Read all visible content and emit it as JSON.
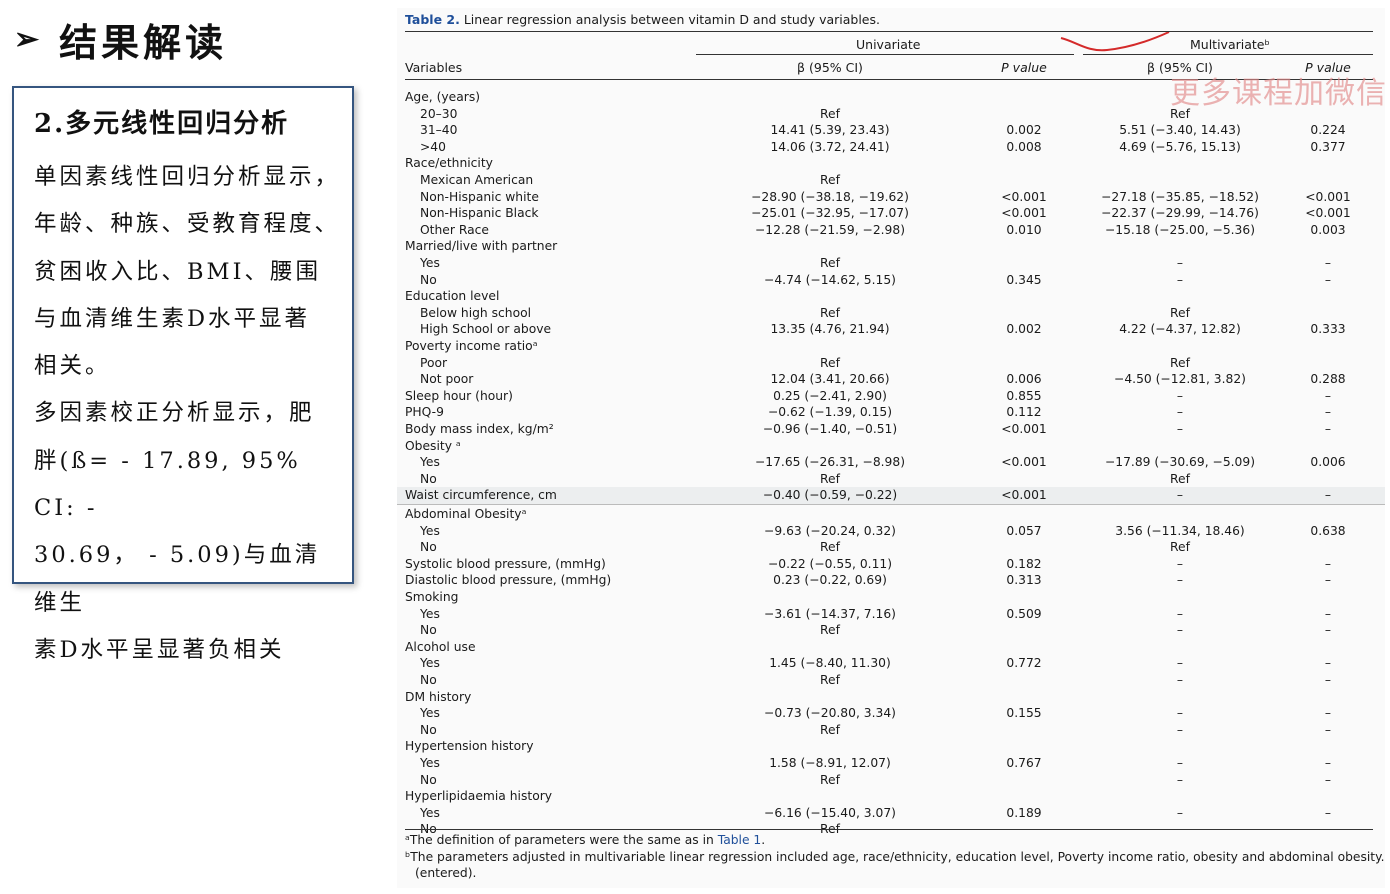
{
  "slide": {
    "title_arrow": "➢",
    "title": "结果解读"
  },
  "summary": {
    "heading": "2.多元线性回归分析",
    "lines": [
      "单因素线性回归分析显示，",
      "年龄、种族、受教育程度、",
      "贫困收入比、BMI、腰围",
      "与血清维生素D水平显著",
      "相关。",
      "多因素校正分析显示，肥",
      "胖(ß= - 17.89, 95% CI: -",
      "30.69，  - 5.09)与血清维生",
      "素D水平呈显著负相关"
    ]
  },
  "table": {
    "caption_label": "Table 2.",
    "caption_text": "Linear regression analysis between vitamin D and study variables.",
    "group_univariate": "Univariate",
    "group_multivariate": "Multivariateᵇ",
    "col_variables": "Variables",
    "col_beta_uni": "β (95% CI)",
    "col_p_uni": "P value",
    "col_beta_multi": "β (95% CI)",
    "col_p_multi": "P value",
    "rows": [
      {
        "label": "Age, (years)",
        "sub": false,
        "b1": "",
        "p1": "",
        "b2": "",
        "p2": ""
      },
      {
        "label": "20–30",
        "sub": true,
        "b1": "Ref",
        "p1": "",
        "b2": "Ref",
        "p2": ""
      },
      {
        "label": "31–40",
        "sub": true,
        "b1": "14.41 (5.39, 23.43)",
        "p1": "0.002",
        "b2": "5.51 (−3.40, 14.43)",
        "p2": "0.224"
      },
      {
        "label": ">40",
        "sub": true,
        "b1": "14.06 (3.72, 24.41)",
        "p1": "0.008",
        "b2": "4.69 (−5.76, 15.13)",
        "p2": "0.377"
      },
      {
        "label": "Race/ethnicity",
        "sub": false,
        "b1": "",
        "p1": "",
        "b2": "",
        "p2": ""
      },
      {
        "label": "Mexican American",
        "sub": true,
        "b1": "Ref",
        "p1": "",
        "b2": "",
        "p2": ""
      },
      {
        "label": "Non-Hispanic white",
        "sub": true,
        "b1": "−28.90 (−38.18, −19.62)",
        "p1": "<0.001",
        "b2": "−27.18 (−35.85, −18.52)",
        "p2": "<0.001"
      },
      {
        "label": "Non-Hispanic Black",
        "sub": true,
        "b1": "−25.01 (−32.95, −17.07)",
        "p1": "<0.001",
        "b2": "−22.37 (−29.99, −14.76)",
        "p2": "<0.001"
      },
      {
        "label": "Other Race",
        "sub": true,
        "b1": "−12.28 (−21.59, −2.98)",
        "p1": "0.010",
        "b2": "−15.18 (−25.00, −5.36)",
        "p2": "0.003"
      },
      {
        "label": "Married/live with partner",
        "sub": false,
        "b1": "",
        "p1": "",
        "b2": "",
        "p2": ""
      },
      {
        "label": "Yes",
        "sub": true,
        "b1": "Ref",
        "p1": "",
        "b2": "–",
        "p2": "–"
      },
      {
        "label": "No",
        "sub": true,
        "b1": "−4.74 (−14.62, 5.15)",
        "p1": "0.345",
        "b2": "–",
        "p2": "–"
      },
      {
        "label": "Education level",
        "sub": false,
        "b1": "",
        "p1": "",
        "b2": "",
        "p2": ""
      },
      {
        "label": "Below high school",
        "sub": true,
        "b1": "Ref",
        "p1": "",
        "b2": "Ref",
        "p2": ""
      },
      {
        "label": "High School or above",
        "sub": true,
        "b1": "13.35 (4.76, 21.94)",
        "p1": "0.002",
        "b2": "4.22 (−4.37, 12.82)",
        "p2": "0.333"
      },
      {
        "label": "Poverty income ratioᵃ",
        "sub": false,
        "b1": "",
        "p1": "",
        "b2": "",
        "p2": ""
      },
      {
        "label": "Poor",
        "sub": true,
        "b1": "Ref",
        "p1": "",
        "b2": "Ref",
        "p2": ""
      },
      {
        "label": "Not poor",
        "sub": true,
        "b1": "12.04 (3.41, 20.66)",
        "p1": "0.006",
        "b2": "−4.50 (−12.81, 3.82)",
        "p2": "0.288"
      },
      {
        "label": "Sleep hour (hour)",
        "sub": false,
        "b1": "0.25 (−2.41, 2.90)",
        "p1": "0.855",
        "b2": "–",
        "p2": "–"
      },
      {
        "label": "PHQ-9",
        "sub": false,
        "b1": "−0.62 (−1.39, 0.15)",
        "p1": "0.112",
        "b2": "–",
        "p2": "–"
      },
      {
        "label": "Body mass index, kg/m²",
        "sub": false,
        "b1": "−0.96 (−1.40, −0.51)",
        "p1": "<0.001",
        "b2": "–",
        "p2": "–"
      },
      {
        "label": "Obesity ᵃ",
        "sub": false,
        "b1": "",
        "p1": "",
        "b2": "",
        "p2": ""
      },
      {
        "label": "Yes",
        "sub": true,
        "b1": "−17.65 (−26.31, −8.98)",
        "p1": "<0.001",
        "b2": "−17.89 (−30.69, −5.09)",
        "p2": "0.006"
      },
      {
        "label": "No",
        "sub": true,
        "b1": "Ref",
        "p1": "",
        "b2": "Ref",
        "p2": ""
      },
      {
        "label": "Waist circumference, cm",
        "sub": false,
        "shade": true,
        "b1": "−0.40 (−0.59, −0.22)",
        "p1": "<0.001",
        "b2": "–",
        "p2": "–"
      },
      {
        "label": "Abdominal Obesityᵃ",
        "sub": false,
        "b1": "",
        "p1": "",
        "b2": "",
        "p2": ""
      },
      {
        "label": "Yes",
        "sub": true,
        "b1": "−9.63 (−20.24, 0.32)",
        "p1": "0.057",
        "b2": "3.56 (−11.34, 18.46)",
        "p2": "0.638"
      },
      {
        "label": "No",
        "sub": true,
        "b1": "Ref",
        "p1": "",
        "b2": "Ref",
        "p2": ""
      },
      {
        "label": "Systolic blood pressure, (mmHg)",
        "sub": false,
        "b1": "−0.22 (−0.55, 0.11)",
        "p1": "0.182",
        "b2": "–",
        "p2": "–"
      },
      {
        "label": "Diastolic blood pressure, (mmHg)",
        "sub": false,
        "b1": "0.23 (−0.22, 0.69)",
        "p1": "0.313",
        "b2": "–",
        "p2": "–"
      },
      {
        "label": "Smoking",
        "sub": false,
        "b1": "",
        "p1": "",
        "b2": "",
        "p2": ""
      },
      {
        "label": "Yes",
        "sub": true,
        "b1": "−3.61 (−14.37, 7.16)",
        "p1": "0.509",
        "b2": "–",
        "p2": "–"
      },
      {
        "label": "No",
        "sub": true,
        "b1": "Ref",
        "p1": "",
        "b2": "–",
        "p2": "–"
      },
      {
        "label": "Alcohol use",
        "sub": false,
        "b1": "",
        "p1": "",
        "b2": "",
        "p2": ""
      },
      {
        "label": "Yes",
        "sub": true,
        "b1": "1.45 (−8.40, 11.30)",
        "p1": "0.772",
        "b2": "–",
        "p2": "–"
      },
      {
        "label": "No",
        "sub": true,
        "b1": "Ref",
        "p1": "",
        "b2": "–",
        "p2": "–"
      },
      {
        "label": "DM history",
        "sub": false,
        "b1": "",
        "p1": "",
        "b2": "",
        "p2": ""
      },
      {
        "label": "Yes",
        "sub": true,
        "b1": "−0.73 (−20.80, 3.34)",
        "p1": "0.155",
        "b2": "–",
        "p2": "–"
      },
      {
        "label": "No",
        "sub": true,
        "b1": "Ref",
        "p1": "",
        "b2": "–",
        "p2": "–"
      },
      {
        "label": "Hypertension history",
        "sub": false,
        "b1": "",
        "p1": "",
        "b2": "",
        "p2": ""
      },
      {
        "label": "Yes",
        "sub": true,
        "b1": "1.58 (−8.91, 12.07)",
        "p1": "0.767",
        "b2": "–",
        "p2": "–"
      },
      {
        "label": "No",
        "sub": true,
        "b1": "Ref",
        "p1": "",
        "b2": "–",
        "p2": "–"
      },
      {
        "label": "Hyperlipidaemia history",
        "sub": false,
        "b1": "",
        "p1": "",
        "b2": "",
        "p2": ""
      },
      {
        "label": "Yes",
        "sub": true,
        "b1": "−6.16 (−15.40, 3.07)",
        "p1": "0.189",
        "b2": "–",
        "p2": "–"
      },
      {
        "label": "No",
        "sub": true,
        "b1": "Ref",
        "p1": "",
        "b2": "–",
        "p2": "–"
      }
    ],
    "footnote_a_prefix": "ᵃThe definition of parameters were the same as in ",
    "footnote_a_link": "Table 1",
    "footnote_a_suffix": ".",
    "footnote_b_line1": "ᵇThe parameters adjusted in multivariable linear regression included age, race/ethnicity, education level, Poverty income ratio, obesity and abdominal obesity.",
    "footnote_b_line2": "(entered)."
  },
  "watermark_text": "更多课程加微信"
}
